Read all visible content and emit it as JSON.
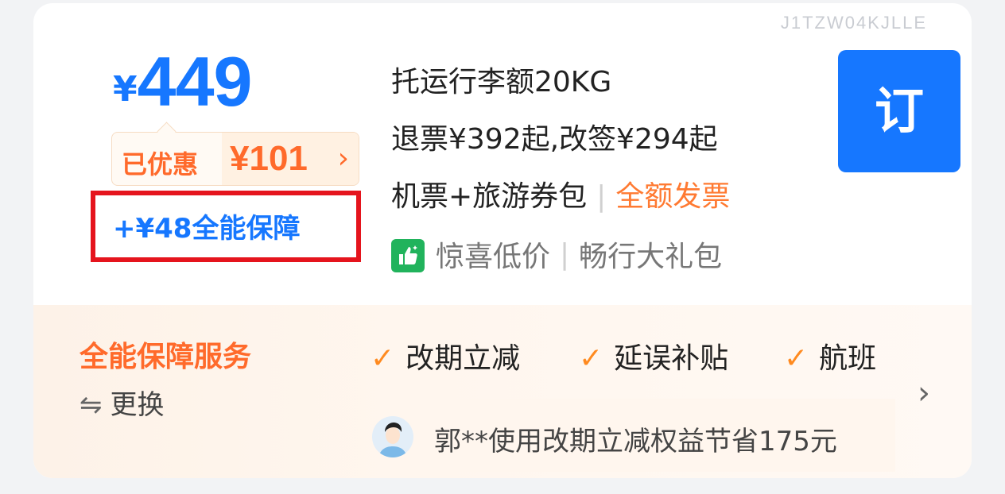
{
  "watermark": "J1TZW04KJLLE",
  "price": {
    "symbol": "¥",
    "amount": "449"
  },
  "discount": {
    "label": "已优惠",
    "amount": "¥101",
    "arrow": "›"
  },
  "protection": {
    "text": "+¥48全能保障"
  },
  "info": {
    "baggage": "托运行李额20KG",
    "refund": "退票¥392起,改签¥294起",
    "package": "机票+旅游券包",
    "invoice": "全额发票",
    "promo": "惊喜低价",
    "gift": "畅行大礼包"
  },
  "order_button": {
    "label": "订"
  },
  "service": {
    "title": "全能保障服务",
    "swap_icon": "⇋",
    "swap_label": "更换",
    "features": [
      "改期立减",
      "延误补贴",
      "航班"
    ],
    "check_icon": "✓",
    "testimonial": "郭**使用改期立减权益节省175元"
  },
  "colors": {
    "brand_blue": "#1677ff",
    "discount_orange": "#ff6a2b",
    "highlight_red": "#e5141d",
    "promo_green": "#21b35c"
  },
  "icons": [
    "thumbs-up-icon",
    "check-icon",
    "swap-icon",
    "chevron-right-icon",
    "avatar"
  ]
}
